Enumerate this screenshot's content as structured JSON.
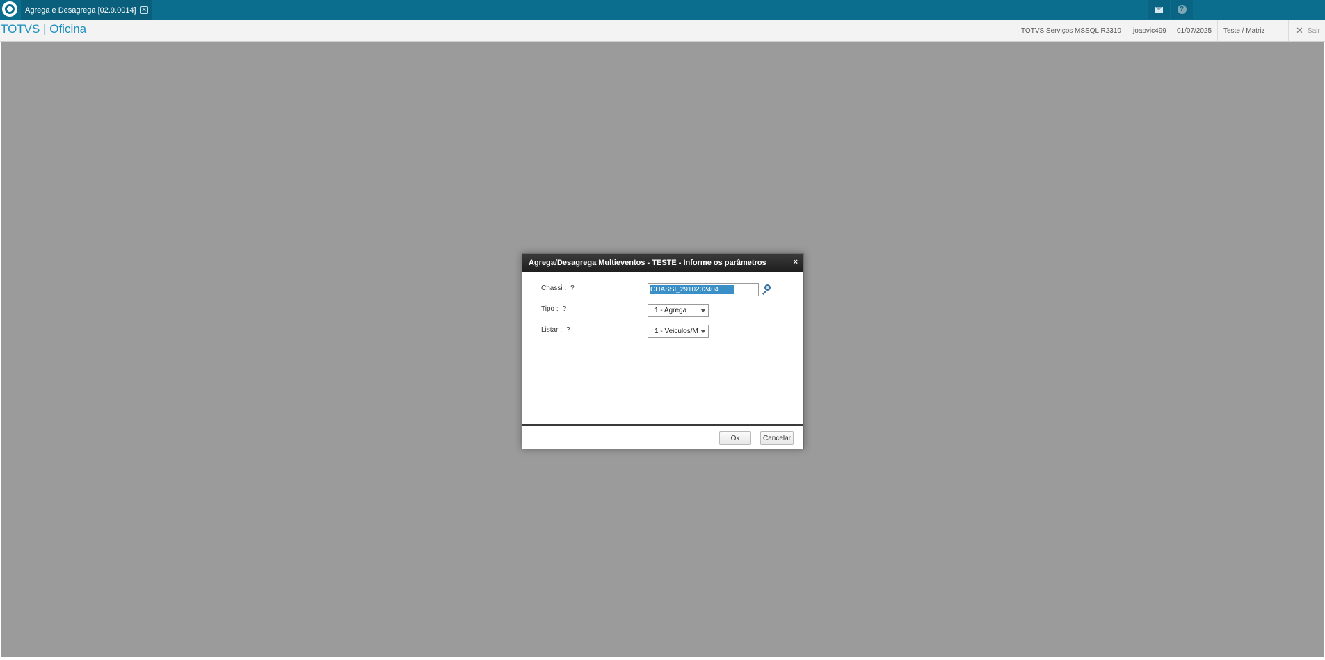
{
  "topbar": {
    "tab_label": "Agrega e Desagrega [02.9.0014]",
    "tab_close_glyph": "✕",
    "icons": [
      "totvs-logo-icon",
      "mail-icon",
      "help-icon"
    ],
    "help_glyph": "?"
  },
  "header": {
    "app_title": "TOTVS | Oficina",
    "environment": "TOTVS Serviços MSSQL R2310",
    "user": "joaovic499",
    "date": "01/07/2025",
    "company": "Teste / Matriz",
    "logout_label": "Sair",
    "logout_glyph": "✕"
  },
  "dialog": {
    "title": "Agrega/Desagrega Multieventos - TESTE - Informe os parâmetros",
    "close_glyph": "×",
    "fields": [
      {
        "label": "Chassi :",
        "help": "?",
        "value": "CHASSI_2910202404"
      },
      {
        "label": "Tipo :",
        "help": "?",
        "value": "1 - Agrega"
      },
      {
        "label": "Listar :",
        "help": "?",
        "value": "1 - Veiculos/M"
      }
    ],
    "ok_label": "Ok",
    "cancel_label": "Cancelar"
  },
  "colors": {
    "topbar": "#0b6e8f",
    "accent": "#1a8fbf",
    "overlay": "#9b9b9b",
    "selection": "#3a8fc6"
  }
}
